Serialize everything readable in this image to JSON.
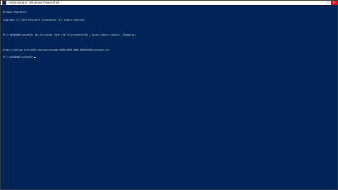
{
  "window": {
    "title": "Administrator: Windows PowerShell"
  },
  "console": {
    "lines": [
      "Windows PowerShell",
      "Copyright (C) 2016 Microsoft Corporation. All rights reserved.",
      "",
      "PS C:\\WINDOWS\\system32> Get-ChildItem -Path Cert:\\CurrentUser\\My | Select-Object Subject, Thumbprint",
      "",
      "https://outlook.office365.com/owa/calendar/0000-0000-0000-0000/0000/calendar.ics",
      "PS C:\\WINDOWS\\system32>"
    ]
  },
  "controls": {
    "minimize": "–",
    "maximize": "□",
    "close": "✕"
  }
}
